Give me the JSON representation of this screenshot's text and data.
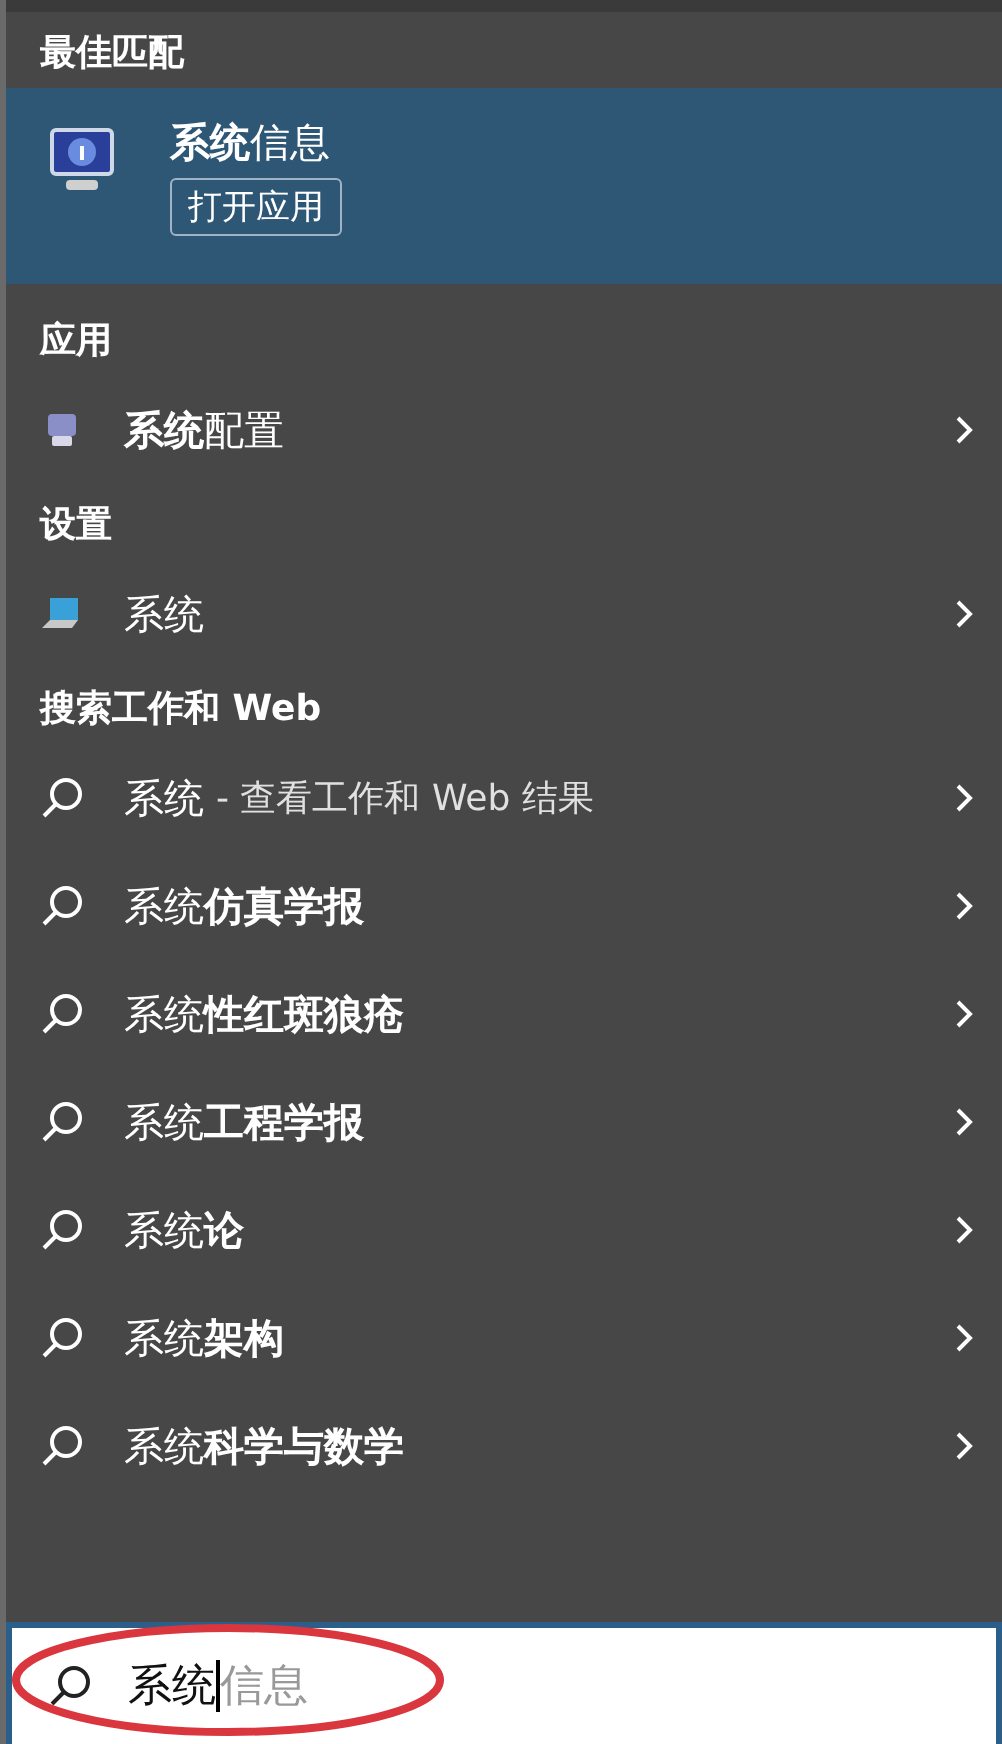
{
  "best_match": {
    "heading": "最佳匹配",
    "title": "**系统**信息",
    "action": "打开应用"
  },
  "sections": [
    {
      "heading": "应用",
      "items": [
        {
          "kind": "app",
          "label": "**系统**配置"
        }
      ]
    },
    {
      "heading": "设置",
      "items": [
        {
          "kind": "settings",
          "label": "系统"
        }
      ]
    },
    {
      "heading": "搜索工作和 Web",
      "items": [
        {
          "kind": "web",
          "label": "系统",
          "note": "- 查看工作和 Web 结果"
        },
        {
          "kind": "web",
          "label": "系统**仿真学报**"
        },
        {
          "kind": "web",
          "label": "系统**性红斑狼疮**"
        },
        {
          "kind": "web",
          "label": "系统**工程学报**"
        },
        {
          "kind": "web",
          "label": "系统**论**"
        },
        {
          "kind": "web",
          "label": "系统**架构**"
        },
        {
          "kind": "web",
          "label": "系统**科学与数学**"
        }
      ]
    }
  ],
  "search": {
    "value": "系统",
    "completion": "信息"
  }
}
